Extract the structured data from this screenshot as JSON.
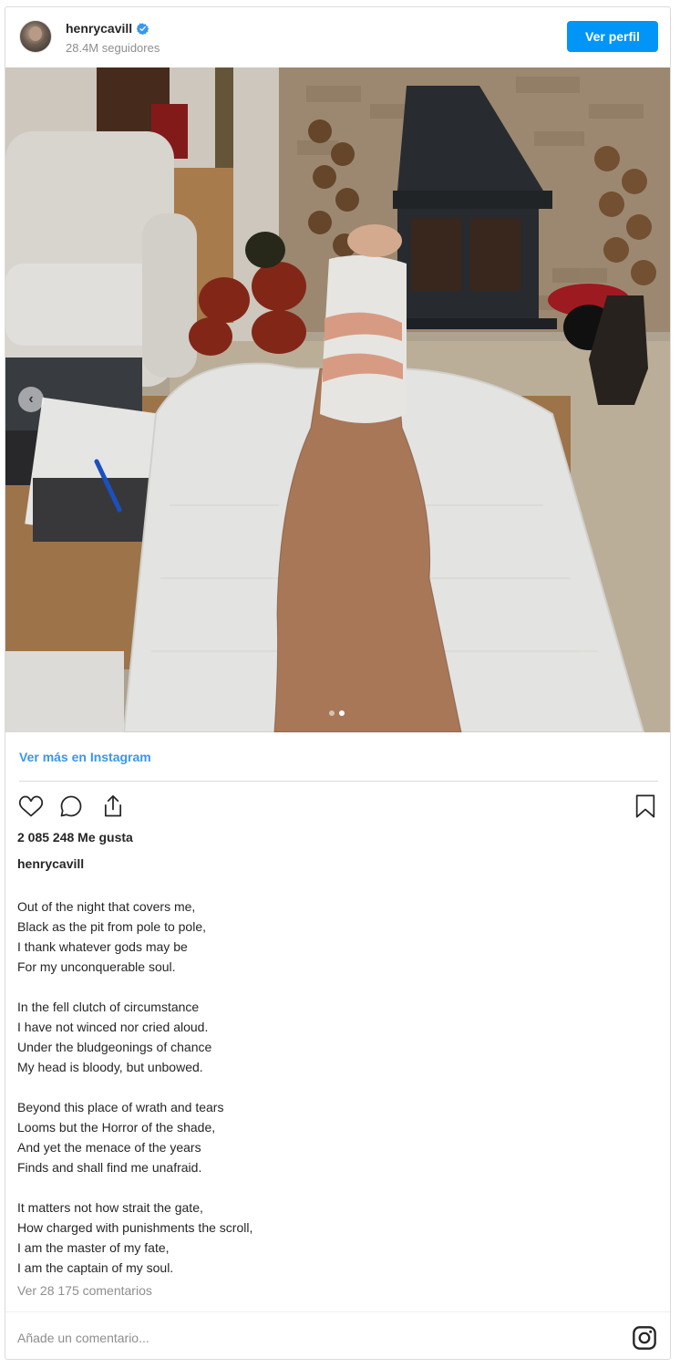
{
  "header": {
    "username": "henrycavill",
    "followers": "28.4M seguidores",
    "view_profile_label": "Ver perfil"
  },
  "post": {
    "view_more_label": "Ver más en Instagram",
    "likes": "2 085 248 Me gusta",
    "caption_user": "henrycavill",
    "caption_stanzas": [
      [
        "Out of the night that covers me,",
        "Black as the pit from pole to pole,",
        "I thank whatever gods may be",
        "For my unconquerable soul."
      ],
      [
        "In the fell clutch of circumstance",
        "I have not winced nor cried aloud.",
        "Under the bludgeonings of chance",
        "My head is bloody, but unbowed."
      ],
      [
        "Beyond this place of wrath and tears",
        "Looms but the Horror of the shade,",
        "And yet the menace of the years",
        "Finds and shall find me unafraid."
      ],
      [
        "It matters not how strait the gate,",
        "How charged with punishments the scroll,",
        "I am the master of my fate,",
        "I am the captain of my soul."
      ]
    ],
    "comments_link": "Ver 28 175 comentarios",
    "comment_placeholder": "Añade un comentario...",
    "carousel": {
      "total": 2,
      "active_index": 1
    }
  },
  "icons": {
    "verified": "verified-badge-icon",
    "like": "heart-icon",
    "comment": "comment-icon",
    "share": "share-icon",
    "save": "bookmark-icon",
    "logo": "instagram-logo-icon",
    "carousel_prev": "chevron-left-icon"
  },
  "colors": {
    "accent": "#0095f6",
    "link": "#3897f0",
    "muted": "#8e8e8e",
    "text": "#262626"
  }
}
